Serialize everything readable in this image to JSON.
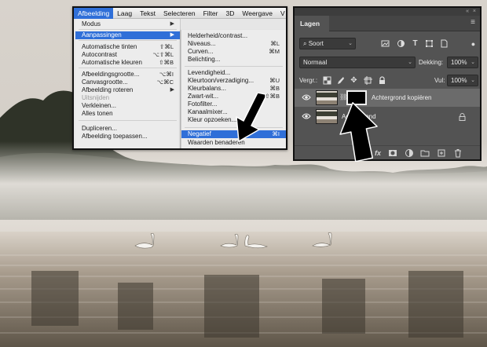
{
  "colors": {
    "menu_highlight": "#2f6fd8",
    "panel_bg": "#535353",
    "selected_row": "#6b6b6b",
    "arrow": "#000000"
  },
  "menubar": {
    "items": [
      "Afbeelding",
      "Laag",
      "Tekst",
      "Selecteren",
      "Filter",
      "3D",
      "Weergave",
      "V"
    ],
    "active_index": 0
  },
  "main_menu": {
    "items": [
      {
        "label": "Modus",
        "arrow": "▶"
      },
      {
        "label": "Aanpassingen",
        "arrow": "▶"
      },
      {
        "label": "Automatische tinten",
        "shortcut": "⇧⌘L"
      },
      {
        "label": "Autocontrast",
        "shortcut": "⌥⇧⌘L"
      },
      {
        "label": "Automatische kleuren",
        "shortcut": "⇧⌘B"
      },
      {
        "label": "Afbeeldingsgrootte...",
        "shortcut": "⌥⌘I"
      },
      {
        "label": "Canvasgrootte...",
        "shortcut": "⌥⌘C"
      },
      {
        "label": "Afbeelding roteren",
        "arrow": "▶"
      },
      {
        "label": "Uitsnijden"
      },
      {
        "label": "Verkleinen..."
      },
      {
        "label": "Alles tonen"
      },
      {
        "label": "Dupliceren..."
      },
      {
        "label": "Afbeelding toepassen..."
      }
    ]
  },
  "sub_menu": {
    "items": [
      {
        "label": "Helderheid/contrast..."
      },
      {
        "label": "Niveaus...",
        "shortcut": "⌘L"
      },
      {
        "label": "Curven...",
        "shortcut": "⌘M"
      },
      {
        "label": "Belichting..."
      },
      {
        "label": "Levendigheid..."
      },
      {
        "label": "Kleurtoon/verzadiging...",
        "shortcut": "⌘U"
      },
      {
        "label": "Kleurbalans...",
        "shortcut": "⌘B"
      },
      {
        "label": "Zwart-wit...",
        "shortcut": "⌥⇧⌘B"
      },
      {
        "label": "Fotofilter..."
      },
      {
        "label": "Kanaalmixer..."
      },
      {
        "label": "Kleur opzoeken..."
      },
      {
        "label": "Negatief",
        "shortcut": "⌘I"
      },
      {
        "label": "Waarden benaderen"
      }
    ]
  },
  "layers_panel": {
    "collapse_glyph": "«",
    "close_glyph": "×",
    "tab_label": "Lagen",
    "menu_glyph": "≡",
    "search_label": "Soort",
    "blend_mode": "Normaal",
    "opacity_label": "Dekking:",
    "opacity_value": "100%",
    "lock_label": "Vergr.:",
    "fill_label": "Vul:",
    "fill_value": "100%",
    "layers": [
      {
        "name": "Achtergrond kopiëren",
        "selected": true
      },
      {
        "name": "Achtergrond",
        "selected": false
      }
    ],
    "bottom_link": "GO",
    "bottom_fx": "fx"
  }
}
